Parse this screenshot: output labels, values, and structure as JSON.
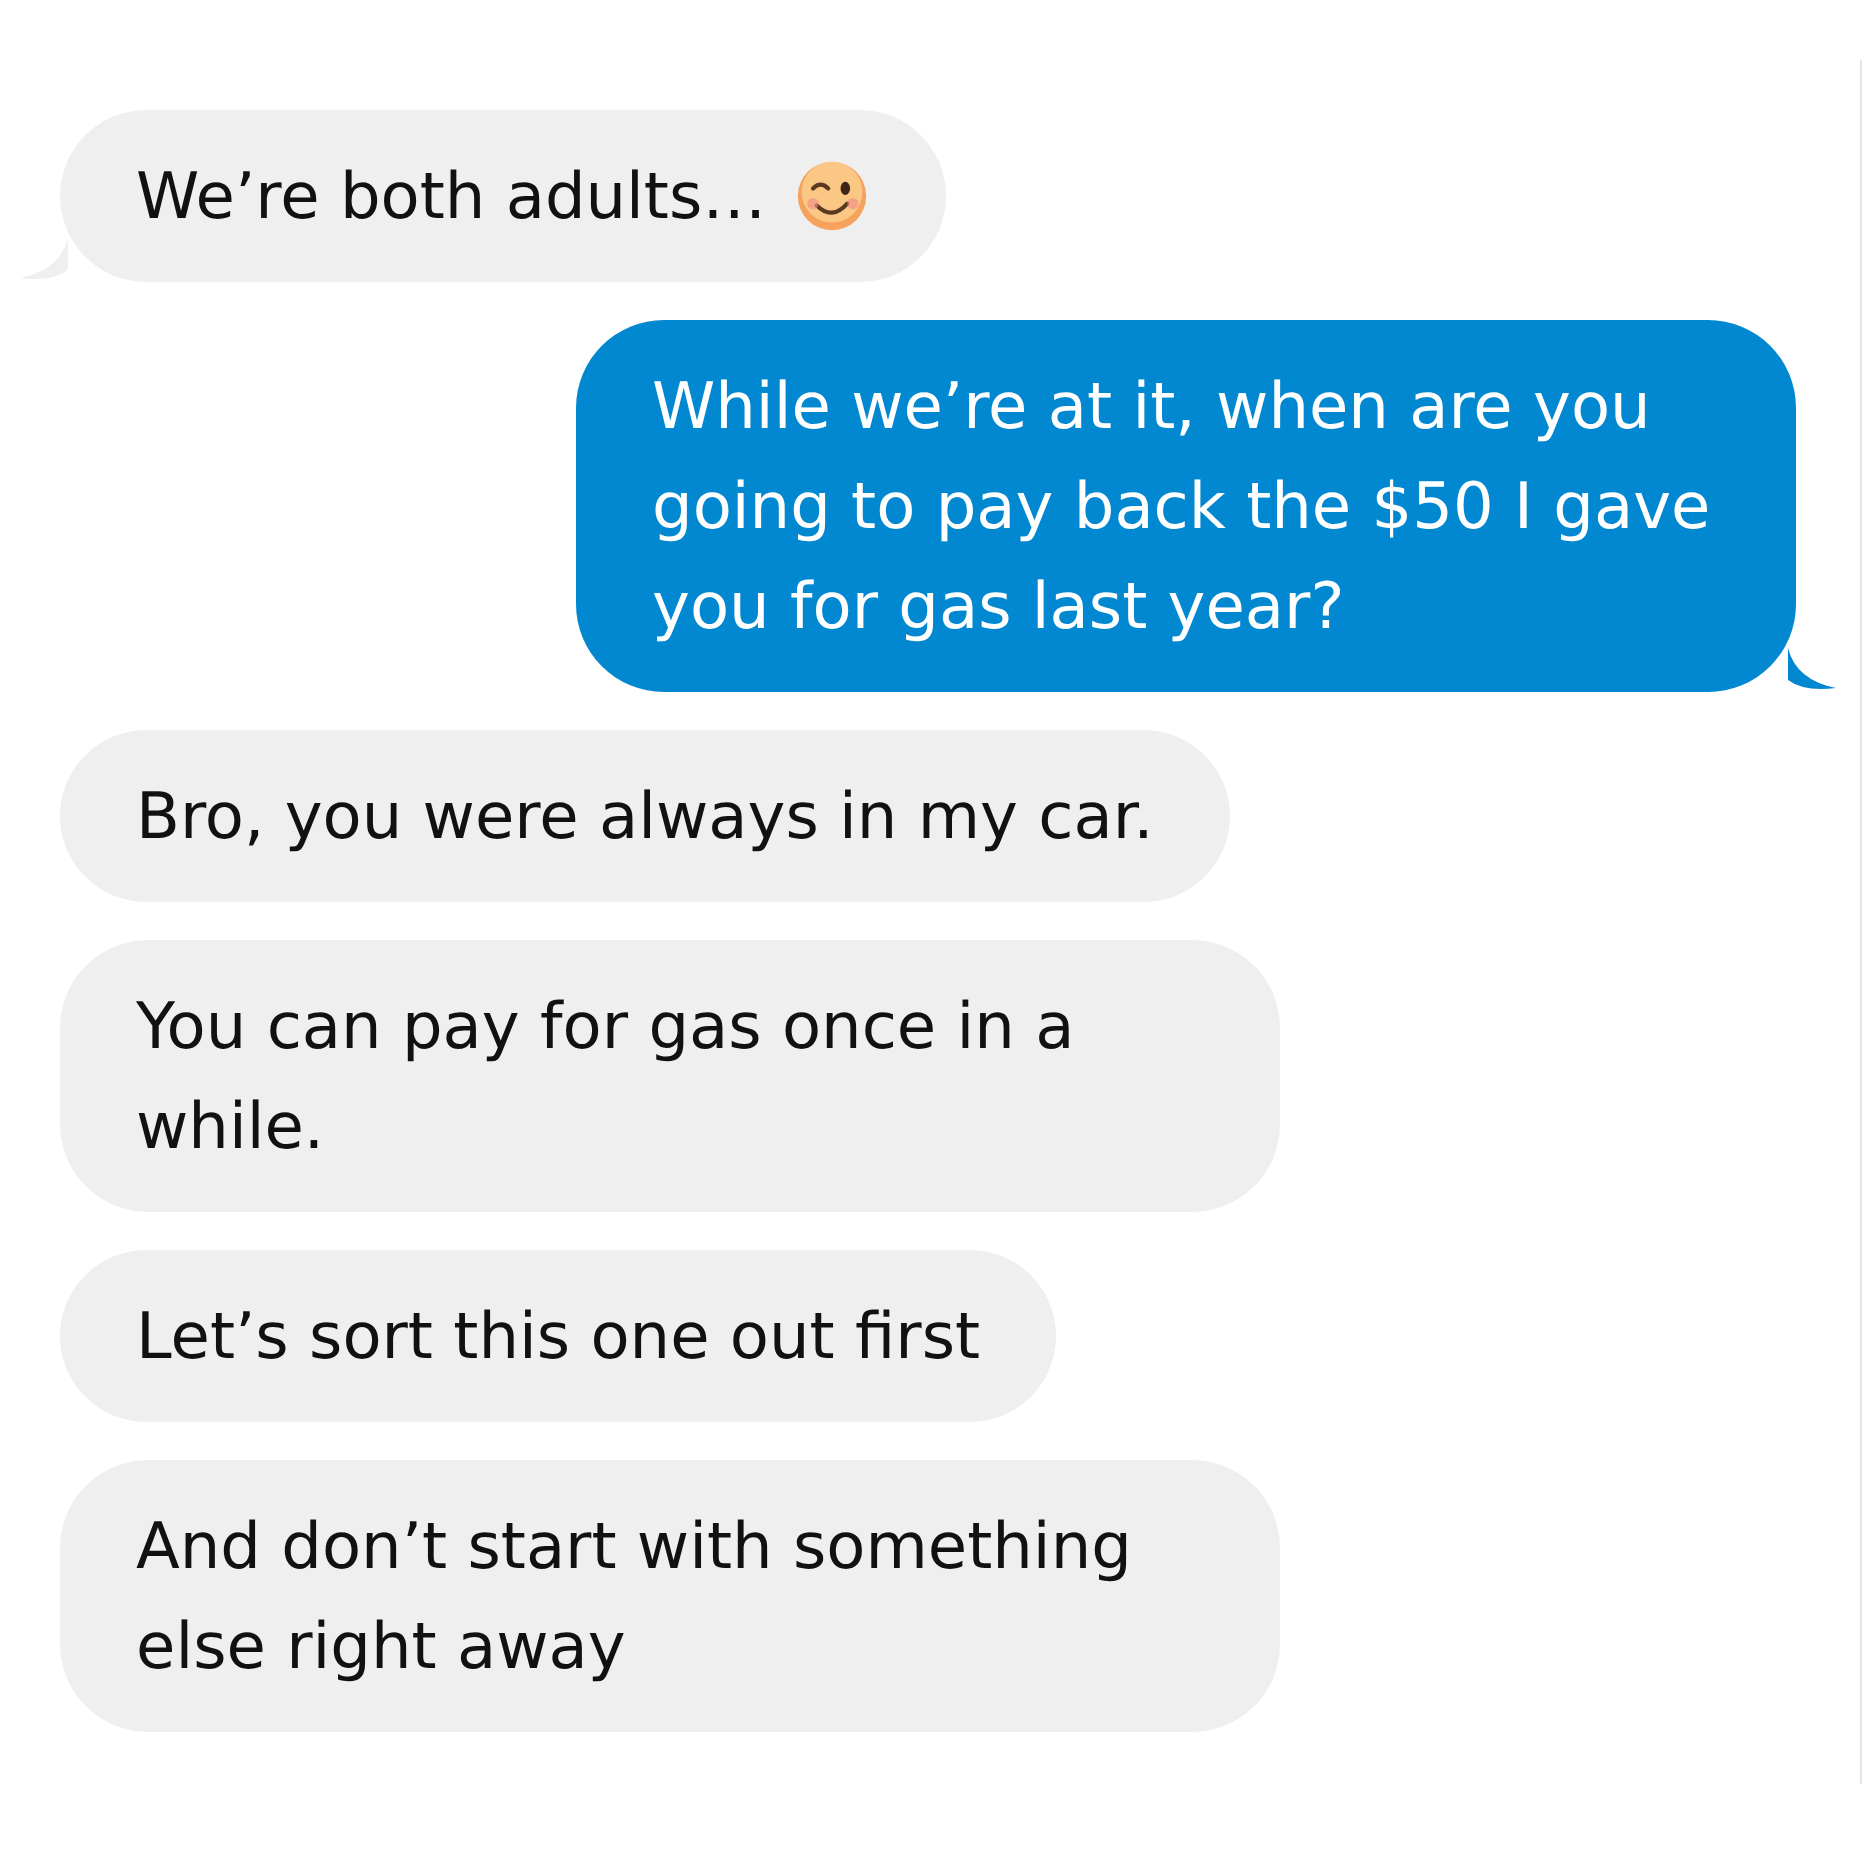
{
  "messages": [
    {
      "kind": "incoming",
      "text": "We’re both adults…",
      "emoji": true,
      "tail": true
    },
    {
      "kind": "outgoing",
      "text": "While we’re at it, when are you going to pay back the $50 I gave you for gas last year?",
      "emoji": false,
      "tail": true
    },
    {
      "kind": "incoming",
      "text": "Bro, you were always in my car.",
      "emoji": false,
      "tail": false
    },
    {
      "kind": "incoming",
      "text": "You can pay for gas once in a while.",
      "emoji": false,
      "tail": false
    },
    {
      "kind": "incoming",
      "text": "Let’s sort this one out first",
      "emoji": false,
      "tail": false
    },
    {
      "kind": "incoming",
      "text": "And don’t start with something else right away",
      "emoji": false,
      "tail": false
    }
  ]
}
